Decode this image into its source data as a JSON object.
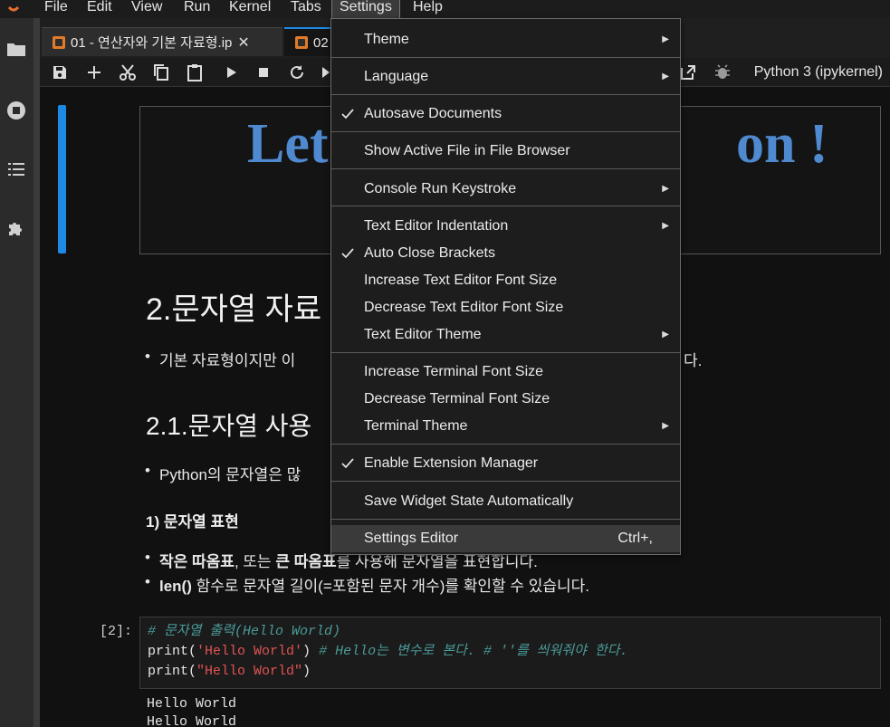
{
  "menubar": {
    "items": [
      "File",
      "Edit",
      "View",
      "Run",
      "Kernel",
      "Tabs",
      "Settings",
      "Help"
    ],
    "active": "Settings"
  },
  "tabs": [
    {
      "label": "01 - 연산자와 기본 자료형.ip",
      "close": "✕"
    },
    {
      "label": "02",
      "close": ""
    }
  ],
  "toolbar": {
    "kernel": "Python 3 (ipykernel)"
  },
  "notebook": {
    "image_title_left": "Let",
    "image_title_right": "on !",
    "heading1": "2.문자열 자료",
    "bullet1_left": "기본 자료형이지만 이",
    "bullet1_right": "다.",
    "heading2": "2.1.문자열 사용",
    "bullet2": "Python의 문자열은 많",
    "subheading": "1) 문자열 표현",
    "bullet3_bold1": "작은 따옴표",
    "bullet3_mid": ", 또는 ",
    "bullet3_bold2": "큰 따옴표",
    "bullet3_rest": "를 사용해 문자열을 표현합니다.",
    "bullet4_bold": "len()",
    "bullet4_rest": " 함수로 문자열 길이(=포함된 문자 개수)를 확인할 수 있습니다.",
    "prompt": "[2]:",
    "code_line1": "# 문자열 출력(Hello World)",
    "code_line2_a": "print(",
    "code_line2_str": "'Hello World'",
    "code_line2_b": ") ",
    "code_line2_comment": "# Hello는 변수로 본다. # ''를 씌워줘야 한다.",
    "code_line3_a": "print(",
    "code_line3_str": "\"Hello World\"",
    "code_line3_b": ")",
    "output1": "Hello World",
    "output2": "Hello World"
  },
  "settings_menu": {
    "theme": "Theme",
    "language": "Language",
    "autosave": "Autosave Documents",
    "show_active": "Show Active File in File Browser",
    "console_run": "Console Run Keystroke",
    "text_indent": "Text Editor Indentation",
    "auto_close": "Auto Close Brackets",
    "inc_text_font": "Increase Text Editor Font Size",
    "dec_text_font": "Decrease Text Editor Font Size",
    "text_theme": "Text Editor Theme",
    "inc_term_font": "Increase Terminal Font Size",
    "dec_term_font": "Decrease Terminal Font Size",
    "term_theme": "Terminal Theme",
    "ext_manager": "Enable Extension Manager",
    "save_widget": "Save Widget State Automatically",
    "settings_editor": "Settings Editor",
    "settings_editor_shortcut": "Ctrl+,"
  },
  "colors": {
    "accent": "#1e88e5",
    "title_blue": "#4f8ad0",
    "string_red": "#e05252",
    "comment_teal": "#4a9a98"
  }
}
